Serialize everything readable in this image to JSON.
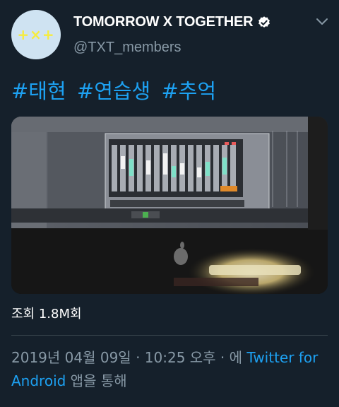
{
  "tweet": {
    "avatar_text": "+×+",
    "display_name": "TOMORROW X TOGETHER",
    "handle": "@TXT_members",
    "hashtags": [
      "#태현",
      "#연습생",
      "#추억"
    ],
    "views": "조회 1.8M회",
    "timestamp": "2019년 04월 09일 · 10:25 오후 · 에 ",
    "source": "Twitter for Android",
    "source_suffix": " 앱을 통해"
  },
  "colors": {
    "background": "#15202b",
    "link": "#1da1f2",
    "secondary_text": "#8899a6",
    "avatar_bg": "#cfe3f2",
    "avatar_fg": "#f6ec3f"
  },
  "icons": [
    "verified-badge-icon",
    "chevron-down-icon"
  ]
}
